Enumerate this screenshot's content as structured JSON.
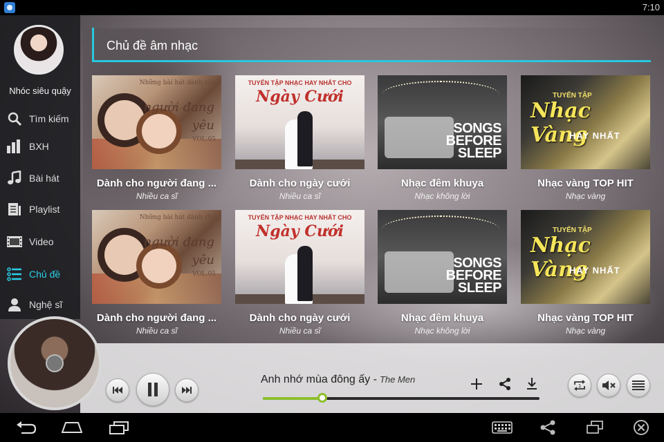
{
  "status_bar": {
    "time": "7:10"
  },
  "profile": {
    "name": "Nhóc siêu quậy"
  },
  "sidebar": {
    "items": [
      {
        "label": "Tìm kiếm",
        "icon": "search-icon"
      },
      {
        "label": "BXH",
        "icon": "chart-icon"
      },
      {
        "label": "Bài hát",
        "icon": "music-note-icon"
      },
      {
        "label": "Playlist",
        "icon": "playlist-icon"
      },
      {
        "label": "Video",
        "icon": "video-icon"
      },
      {
        "label": "Chủ đề",
        "icon": "topic-list-icon",
        "active": true
      },
      {
        "label": "Nghệ sĩ",
        "icon": "artist-icon"
      }
    ]
  },
  "section": {
    "title": "Chủ đề âm nhạc"
  },
  "cards": [
    {
      "title": "Dành cho người đang ...",
      "subtitle": "Nhiều ca sĩ",
      "art_line1": "Những bài hát dành cho",
      "art_line2": "người đang yêu",
      "art_line3": "VOL.05"
    },
    {
      "title": "Dành cho ngày cưới",
      "subtitle": "Nhiều ca sĩ",
      "art_line1": "TUYỂN TẬP NHẠC HAY NHẤT CHO",
      "art_line2": "Ngày Cưới"
    },
    {
      "title": "Nhạc đêm khuya",
      "subtitle": "Nhạc không lời",
      "art_line1": "SONGS BEFORE SLEEP"
    },
    {
      "title": "Nhạc vàng TOP HIT",
      "subtitle": "Nhạc vàng",
      "art_line1": "TUYỂN TẬP",
      "art_line2": "Nhạc Vàng",
      "art_line3": "HAY NHẤT"
    },
    {
      "title": "Dành cho người đang ...",
      "subtitle": "Nhiều ca sĩ",
      "art_line1": "Những bài hát dành cho",
      "art_line2": "người đang yêu",
      "art_line3": "VOL.05"
    },
    {
      "title": "Dành cho ngày cưới",
      "subtitle": "Nhiều ca sĩ",
      "art_line1": "TUYỂN TẬP NHẠC HAY NHẤT CHO",
      "art_line2": "Ngày Cưới"
    },
    {
      "title": "Nhạc đêm khuya",
      "subtitle": "Nhạc không lời",
      "art_line1": "SONGS BEFORE SLEEP"
    },
    {
      "title": "Nhạc vàng TOP HIT",
      "subtitle": "Nhạc vàng",
      "art_line1": "TUYỂN TẬP",
      "art_line2": "Nhạc Vàng",
      "art_line3": "HAY NHẤT"
    }
  ],
  "player": {
    "song_title": "Anh nhớ mùa đông ấy -",
    "artist": "The Men",
    "progress": 0.215,
    "accent_color": "#8cbf2c"
  },
  "colors": {
    "accent": "#27c8e0",
    "active_nav": "#2ad0e8"
  }
}
